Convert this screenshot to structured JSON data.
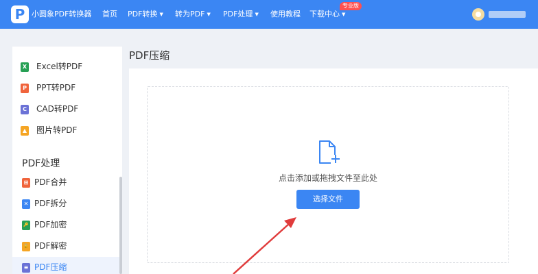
{
  "header": {
    "brand": "小圆象PDF转换器",
    "nav": [
      {
        "label": "首页",
        "dropdown": false
      },
      {
        "label": "PDF转换",
        "dropdown": true
      },
      {
        "label": "转为PDF",
        "dropdown": true
      },
      {
        "label": "PDF处理",
        "dropdown": true
      },
      {
        "label": "使用教程",
        "dropdown": false
      },
      {
        "label": "下载中心",
        "dropdown": true
      }
    ],
    "pro_badge": "专业版",
    "caret": "▼",
    "logo_letter": "P"
  },
  "sidebar": {
    "top_items": [
      {
        "label": "Excel转PDF",
        "icon": "excel-file-icon",
        "icon_letter": "X",
        "color": "#27a055"
      },
      {
        "label": "PPT转PDF",
        "icon": "ppt-file-icon",
        "icon_letter": "P",
        "color": "#f0643c"
      },
      {
        "label": "CAD转PDF",
        "icon": "cad-file-icon",
        "icon_letter": "C",
        "color": "#6b72d6"
      },
      {
        "label": "图片转PDF",
        "icon": "image-file-icon",
        "icon_letter": "▲",
        "color": "#f5a524"
      }
    ],
    "section_title": "PDF处理",
    "sub_items": [
      {
        "label": "PDF合并",
        "icon": "merge-icon",
        "icon_letter": "⊞",
        "color": "#f0643c",
        "active": false
      },
      {
        "label": "PDF拆分",
        "icon": "split-icon",
        "icon_letter": "✕",
        "color": "#3b86f3",
        "active": false
      },
      {
        "label": "PDF加密",
        "icon": "encrypt-icon",
        "icon_letter": "🔑",
        "color": "#27a055",
        "active": false
      },
      {
        "label": "PDF解密",
        "icon": "decrypt-icon",
        "icon_letter": "🔓",
        "color": "#f5a524",
        "active": false
      },
      {
        "label": "PDF压缩",
        "icon": "compress-icon",
        "icon_letter": "≡",
        "color": "#6b72d6",
        "active": true
      }
    ]
  },
  "main": {
    "title": "PDF压缩",
    "drop_hint": "点击添加或拖拽文件至此处",
    "select_button": "选择文件"
  },
  "colors": {
    "accent": "#3b86f3",
    "annotation_arrow": "#e03c3c"
  }
}
